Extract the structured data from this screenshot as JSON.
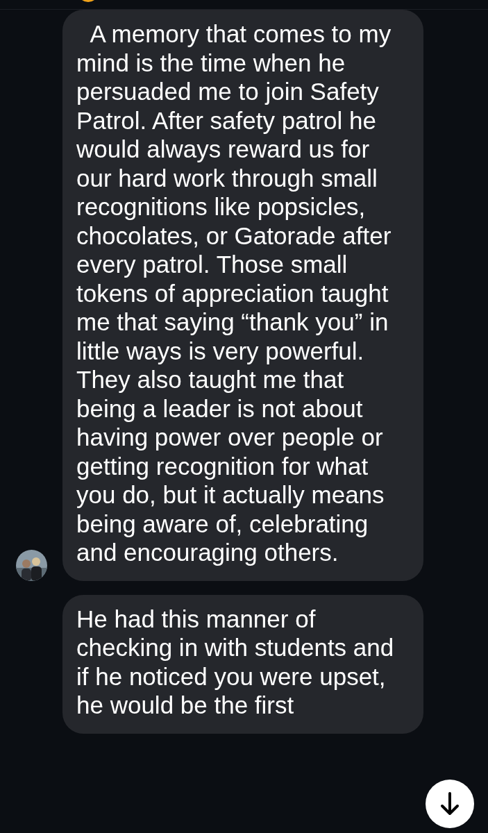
{
  "messages": [
    {
      "kind": "incoming",
      "show_avatar": true,
      "text": "  A memory that comes to my mind is the time when he persuaded me to join Safety Patrol. After safety patrol he would always reward us for our hard work through small recognitions like popsicles, chocolates, or Gatorade after every patrol. Those small tokens of appreciation taught me that saying “thank you” in little ways is very powerful. They also taught me that being a leader is not about having power over people or getting recognition for what you do, but it actually means being aware of, celebrating and encouraging others."
    },
    {
      "kind": "incoming",
      "show_avatar": false,
      "text": "He had this manner of checking in with students and if he noticed you were upset, he would be the first"
    }
  ]
}
